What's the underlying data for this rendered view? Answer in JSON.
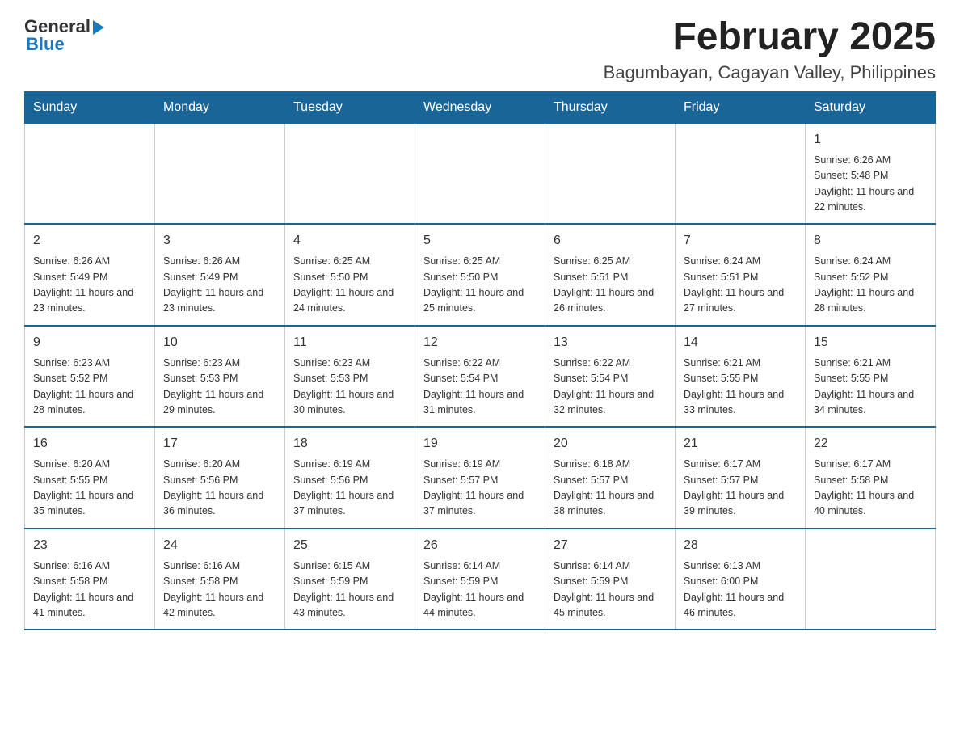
{
  "logo": {
    "general": "General",
    "blue": "Blue"
  },
  "header": {
    "title": "February 2025",
    "subtitle": "Bagumbayan, Cagayan Valley, Philippines"
  },
  "weekdays": [
    "Sunday",
    "Monday",
    "Tuesday",
    "Wednesday",
    "Thursday",
    "Friday",
    "Saturday"
  ],
  "weeks": [
    [
      {
        "day": "",
        "info": ""
      },
      {
        "day": "",
        "info": ""
      },
      {
        "day": "",
        "info": ""
      },
      {
        "day": "",
        "info": ""
      },
      {
        "day": "",
        "info": ""
      },
      {
        "day": "",
        "info": ""
      },
      {
        "day": "1",
        "info": "Sunrise: 6:26 AM\nSunset: 5:48 PM\nDaylight: 11 hours and 22 minutes."
      }
    ],
    [
      {
        "day": "2",
        "info": "Sunrise: 6:26 AM\nSunset: 5:49 PM\nDaylight: 11 hours and 23 minutes."
      },
      {
        "day": "3",
        "info": "Sunrise: 6:26 AM\nSunset: 5:49 PM\nDaylight: 11 hours and 23 minutes."
      },
      {
        "day": "4",
        "info": "Sunrise: 6:25 AM\nSunset: 5:50 PM\nDaylight: 11 hours and 24 minutes."
      },
      {
        "day": "5",
        "info": "Sunrise: 6:25 AM\nSunset: 5:50 PM\nDaylight: 11 hours and 25 minutes."
      },
      {
        "day": "6",
        "info": "Sunrise: 6:25 AM\nSunset: 5:51 PM\nDaylight: 11 hours and 26 minutes."
      },
      {
        "day": "7",
        "info": "Sunrise: 6:24 AM\nSunset: 5:51 PM\nDaylight: 11 hours and 27 minutes."
      },
      {
        "day": "8",
        "info": "Sunrise: 6:24 AM\nSunset: 5:52 PM\nDaylight: 11 hours and 28 minutes."
      }
    ],
    [
      {
        "day": "9",
        "info": "Sunrise: 6:23 AM\nSunset: 5:52 PM\nDaylight: 11 hours and 28 minutes."
      },
      {
        "day": "10",
        "info": "Sunrise: 6:23 AM\nSunset: 5:53 PM\nDaylight: 11 hours and 29 minutes."
      },
      {
        "day": "11",
        "info": "Sunrise: 6:23 AM\nSunset: 5:53 PM\nDaylight: 11 hours and 30 minutes."
      },
      {
        "day": "12",
        "info": "Sunrise: 6:22 AM\nSunset: 5:54 PM\nDaylight: 11 hours and 31 minutes."
      },
      {
        "day": "13",
        "info": "Sunrise: 6:22 AM\nSunset: 5:54 PM\nDaylight: 11 hours and 32 minutes."
      },
      {
        "day": "14",
        "info": "Sunrise: 6:21 AM\nSunset: 5:55 PM\nDaylight: 11 hours and 33 minutes."
      },
      {
        "day": "15",
        "info": "Sunrise: 6:21 AM\nSunset: 5:55 PM\nDaylight: 11 hours and 34 minutes."
      }
    ],
    [
      {
        "day": "16",
        "info": "Sunrise: 6:20 AM\nSunset: 5:55 PM\nDaylight: 11 hours and 35 minutes."
      },
      {
        "day": "17",
        "info": "Sunrise: 6:20 AM\nSunset: 5:56 PM\nDaylight: 11 hours and 36 minutes."
      },
      {
        "day": "18",
        "info": "Sunrise: 6:19 AM\nSunset: 5:56 PM\nDaylight: 11 hours and 37 minutes."
      },
      {
        "day": "19",
        "info": "Sunrise: 6:19 AM\nSunset: 5:57 PM\nDaylight: 11 hours and 37 minutes."
      },
      {
        "day": "20",
        "info": "Sunrise: 6:18 AM\nSunset: 5:57 PM\nDaylight: 11 hours and 38 minutes."
      },
      {
        "day": "21",
        "info": "Sunrise: 6:17 AM\nSunset: 5:57 PM\nDaylight: 11 hours and 39 minutes."
      },
      {
        "day": "22",
        "info": "Sunrise: 6:17 AM\nSunset: 5:58 PM\nDaylight: 11 hours and 40 minutes."
      }
    ],
    [
      {
        "day": "23",
        "info": "Sunrise: 6:16 AM\nSunset: 5:58 PM\nDaylight: 11 hours and 41 minutes."
      },
      {
        "day": "24",
        "info": "Sunrise: 6:16 AM\nSunset: 5:58 PM\nDaylight: 11 hours and 42 minutes."
      },
      {
        "day": "25",
        "info": "Sunrise: 6:15 AM\nSunset: 5:59 PM\nDaylight: 11 hours and 43 minutes."
      },
      {
        "day": "26",
        "info": "Sunrise: 6:14 AM\nSunset: 5:59 PM\nDaylight: 11 hours and 44 minutes."
      },
      {
        "day": "27",
        "info": "Sunrise: 6:14 AM\nSunset: 5:59 PM\nDaylight: 11 hours and 45 minutes."
      },
      {
        "day": "28",
        "info": "Sunrise: 6:13 AM\nSunset: 6:00 PM\nDaylight: 11 hours and 46 minutes."
      },
      {
        "day": "",
        "info": ""
      }
    ]
  ]
}
